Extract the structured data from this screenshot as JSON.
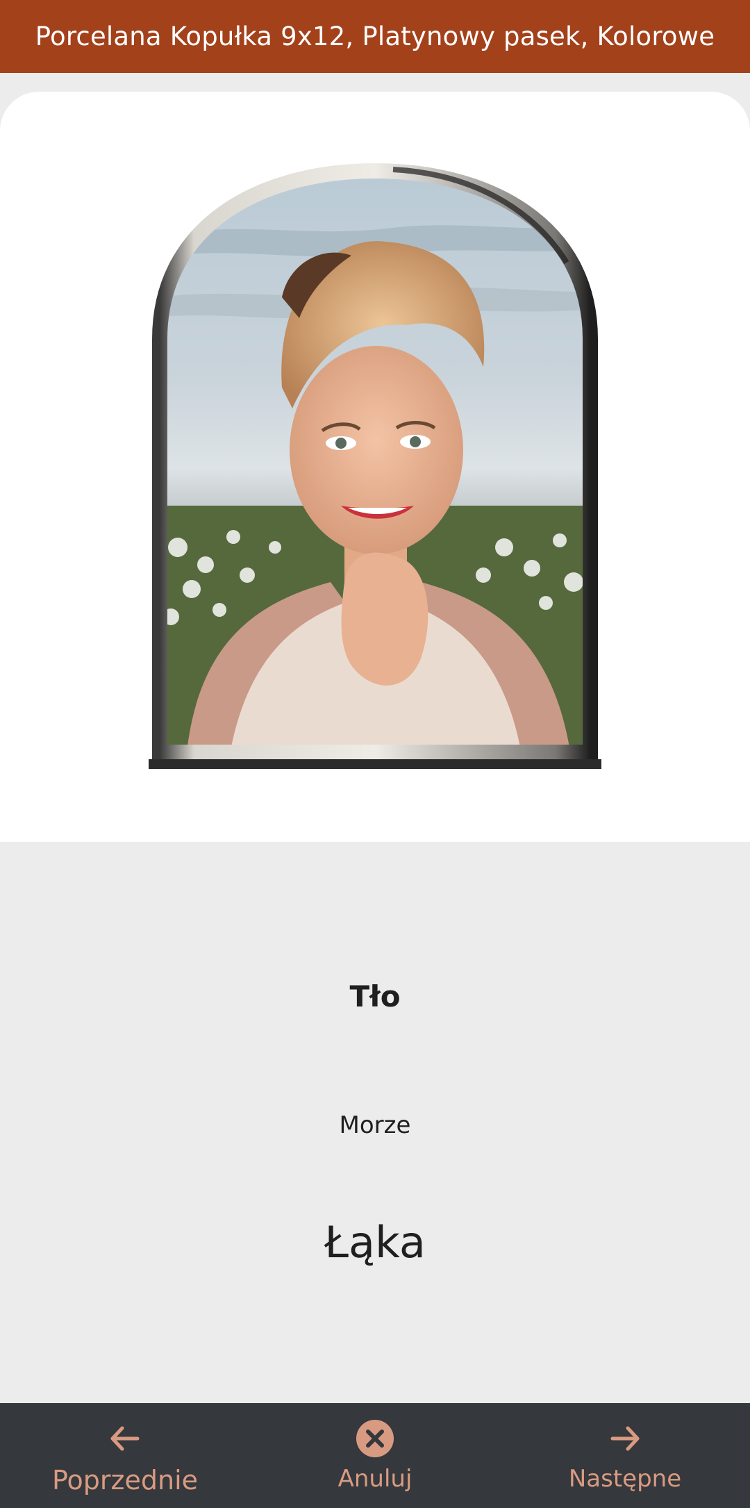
{
  "header": {
    "title": "Porcelana Kopułka 9x12, Platynowy pasek, Kolorowe"
  },
  "preview": {
    "image_alt": "Portrait of smiling blonde woman in lace blouse on meadow background"
  },
  "background_picker": {
    "title": "Tło",
    "options": [
      {
        "label": "Morze"
      },
      {
        "label": "Łąka"
      }
    ]
  },
  "nav": {
    "prev_label": "Poprzednie",
    "cancel_label": "Anuluj",
    "next_label": "Następne"
  },
  "colors": {
    "brand": "#a3411b",
    "nav_bg": "#35383c",
    "nav_accent": "#d89b82",
    "page_bg": "#ececec"
  }
}
